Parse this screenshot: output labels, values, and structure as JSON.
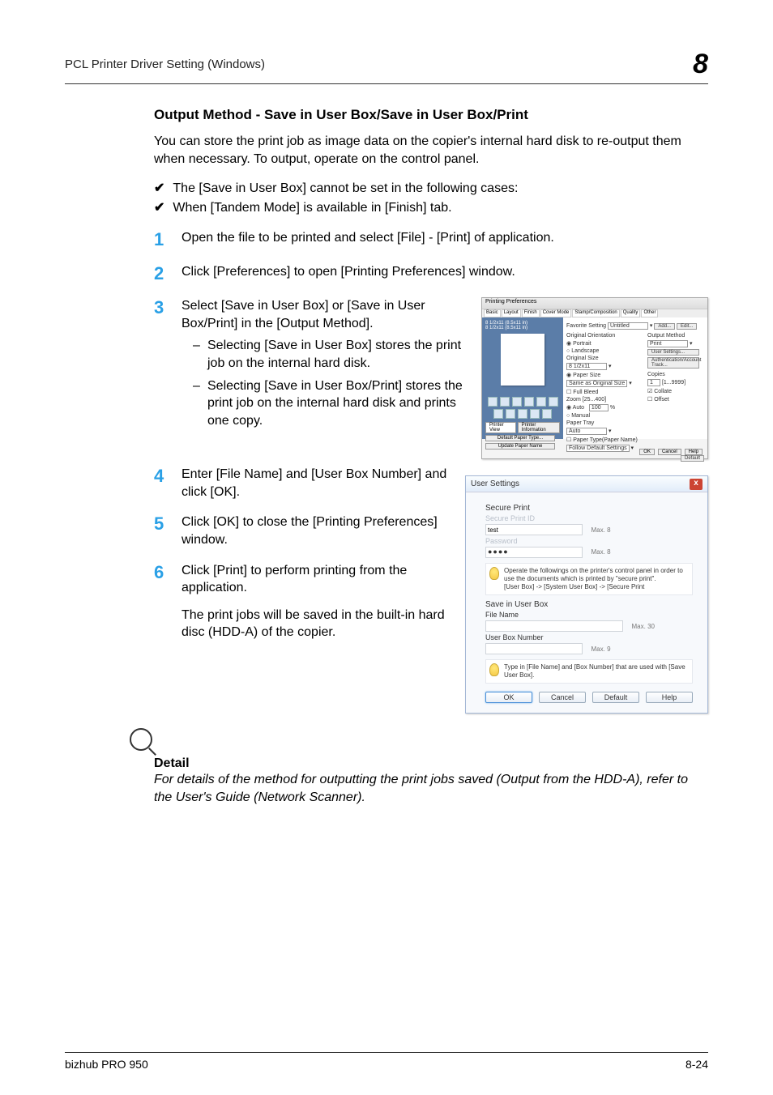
{
  "header": {
    "title": "PCL Printer Driver Setting (Windows)",
    "chapter": "8"
  },
  "section_title": "Output Method - Save in User Box/Save in User Box/Print",
  "intro": "You can store the print job as image data on the copier's internal hard disk to re-output them when necessary. To output, operate on the control panel.",
  "checks": [
    "The [Save in User Box] cannot be set in the following cases:",
    "When [Tandem Mode] is available in [Finish] tab."
  ],
  "steps": {
    "s1": "Open the file to be printed and select [File] - [Print] of application.",
    "s2": "Click [Preferences] to open [Printing Preferences] window.",
    "s3": "Select [Save in User Box] or [Save in User Box/Print] in the [Output Method].",
    "s3a": "Selecting [Save in User Box] stores the print job on the internal hard disk.",
    "s3b": "Selecting [Save in User Box/Print] stores the print job on the internal hard disk and prints one copy.",
    "s4": "Enter [File Name] and [User Box Number] and click [OK].",
    "s5": "Click [OK] to close the [Printing Preferences] window.",
    "s6": "Click [Print] to perform printing from the application.",
    "s6_after": "The print jobs will be saved in the built-in hard disc (HDD-A) of the copier."
  },
  "detail": {
    "heading": "Detail",
    "text": "For details of the method for outputting the print jobs saved (Output from the HDD-A), refer to  the User's Guide (Network Scanner)."
  },
  "mock_prefs": {
    "title": "Printing Preferences",
    "tabs": [
      "Basic",
      "Layout",
      "Finish",
      "Cover Mode",
      "Stamp/Composition",
      "Quality",
      "Other"
    ],
    "favorite_label": "Favorite Setting",
    "favorite_value": "Untitled",
    "add_btn": "Add...",
    "edit_btn": "Edit...",
    "orientation_label": "Original Orientation",
    "portrait": "Portrait",
    "landscape": "Landscape",
    "original_size_label": "Original Size",
    "original_size_value": "8 1/2x11",
    "paper_size_label": "Paper Size",
    "paper_size_value": "Same as Original Size",
    "full_bleed": "Full Bleed",
    "zoom_label": "Zoom [25...400]",
    "zoom_auto": "Auto",
    "zoom_manual": "Manual",
    "paper_tray_label": "Paper Tray",
    "paper_tray_value": "Auto",
    "paper_type_label": "Paper Type(Paper Name)",
    "paper_type_value": "Follow Default Settings",
    "output_method_label": "Output Method",
    "output_method_value": "Print",
    "user_settings_btn": "User Settings...",
    "auth_btn": "Authentication/Account Track...",
    "copies_label": "Copies",
    "copies_value": "1",
    "copies_range": "[1...9999]",
    "collate": "Collate",
    "offset": "Offset",
    "printer_view_btn": "Printer View",
    "printer_info_btn": "Printer Information",
    "default_paper_btn": "Default Paper Type...",
    "update_paper_btn": "Update Paper Name",
    "default_btn": "Default",
    "ok": "OK",
    "cancel": "Cancel",
    "help": "Help"
  },
  "mock_user": {
    "title": "User Settings",
    "secure_print": "Secure Print",
    "secure_print_id": "Secure Print ID",
    "id_value": "test",
    "id_max": "Max. 8",
    "password_label": "Password",
    "password_dots": "●●●●",
    "password_max": "Max. 8",
    "info1": "Operate the followings on the printer's control panel in order to use the documents which is printed by \"secure print\".",
    "info1b": "[User Box] -> [System User Box] -> [Secure Print",
    "save_section": "Save in User Box",
    "file_name_label": "File Name",
    "file_name_max": "Max. 30",
    "box_number_label": "User Box Number",
    "box_number_max": "Max. 9",
    "info2": "Type in [File Name] and [Box Number] that are used with [Save User Box].",
    "ok": "OK",
    "cancel": "Cancel",
    "default": "Default",
    "help": "Help"
  },
  "footer": {
    "product": "bizhub PRO 950",
    "page": "8-24"
  }
}
